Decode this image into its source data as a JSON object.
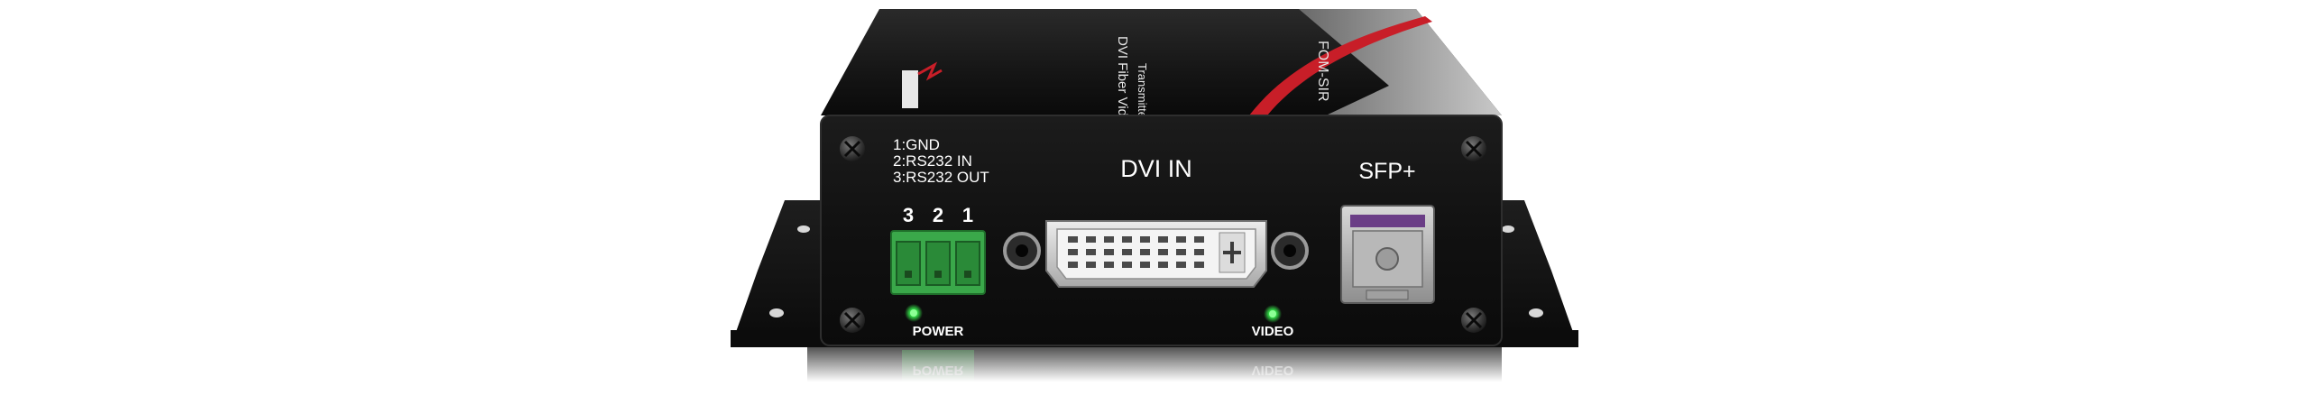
{
  "device": {
    "top_label": {
      "product": "DVI Fiber Video Optical Converter",
      "role": "Transmitter",
      "model": "FOM-SIR"
    },
    "pin_legend": [
      "1:GND",
      "2:RS232 IN",
      "3:RS232 OUT"
    ],
    "terminal_numbers": [
      "3",
      "2",
      "1"
    ],
    "port_labels": {
      "dvi": "DVI IN",
      "sfp": "SFP+"
    },
    "led_labels": {
      "power": "POWER",
      "video": "VIDEO"
    },
    "colors": {
      "chassis": "#141414",
      "terminal_block": "#3aa84a",
      "led": "#35e04a",
      "swoosh": "#c81e28"
    }
  }
}
